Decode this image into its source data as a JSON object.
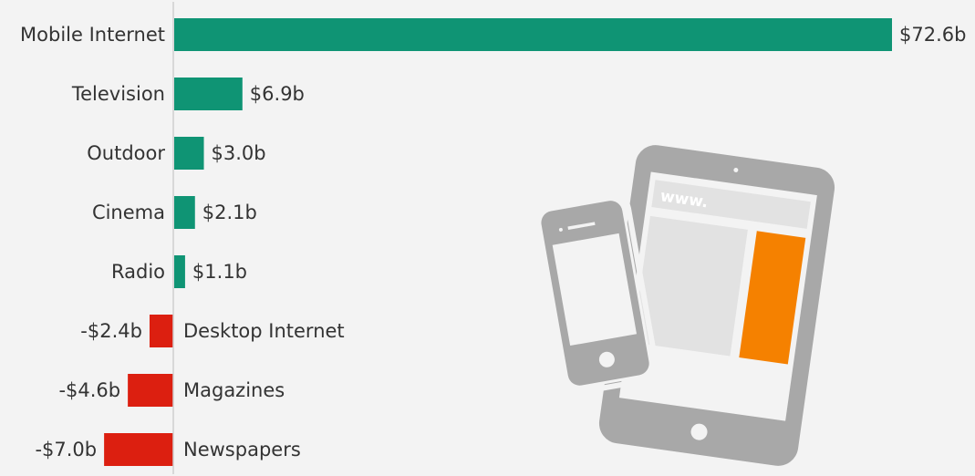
{
  "chart_data": {
    "type": "bar",
    "orientation": "horizontal",
    "categories": [
      "Mobile Internet",
      "Television",
      "Outdoor",
      "Cinema",
      "Radio",
      "Desktop Internet",
      "Magazines",
      "Newspapers"
    ],
    "values": [
      72.6,
      6.9,
      3.0,
      2.1,
      1.1,
      -2.4,
      -4.6,
      -7.0
    ],
    "value_labels": [
      "$72.6b",
      "$6.9b",
      "$3.0b",
      "$2.1b",
      "$1.1b",
      "-$2.4b",
      "-$4.6b",
      "-$7.0b"
    ],
    "title": "",
    "xlabel": "",
    "ylabel": "",
    "grid": false,
    "colors": {
      "positive": "#0f9474",
      "negative": "#dc1f10"
    }
  },
  "illustration": {
    "browser_text": "www.",
    "colors": {
      "device": "#a8a8a8",
      "screen": "#e2e2e2",
      "accent": "#f58100"
    }
  }
}
